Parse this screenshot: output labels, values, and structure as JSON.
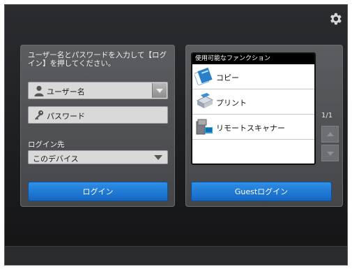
{
  "login": {
    "instructions": "ユーザー名とパスワードを入力して【ログイン】を押してください。",
    "username_label": "ユーザー名",
    "password_label": "パスワード",
    "destination_label": "ログイン先",
    "destination_value": "このデバイス",
    "login_button": "ログイン"
  },
  "functions": {
    "header": "使用可能なファンクション",
    "items": [
      {
        "label": "コピー",
        "icon": "copy-icon"
      },
      {
        "label": "プリント",
        "icon": "printer-icon"
      },
      {
        "label": "リモートスキャナー",
        "icon": "scanner-icon"
      }
    ],
    "page_indicator": "1/1",
    "guest_button": "Guestログイン"
  },
  "colors": {
    "accent": "#1e78d6",
    "panel": "#505255",
    "background": "#1f2022"
  },
  "icons": [
    "gear-icon",
    "user-icon",
    "key-icon",
    "chevron-down-icon",
    "arrow-up-icon",
    "arrow-down-icon"
  ]
}
